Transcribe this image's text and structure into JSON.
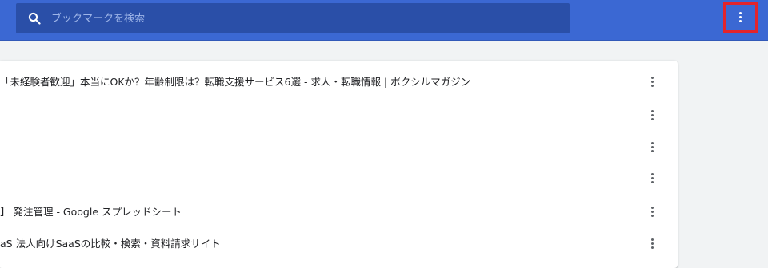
{
  "colors": {
    "toolbar": "#3b68d3",
    "search_bg": "#2a4fa8",
    "highlight": "#e3242b",
    "panel_bg": "#ffffff",
    "page_bg": "#f1f3f4",
    "text": "#202124",
    "icon_gray": "#5f6368"
  },
  "toolbar": {
    "search": {
      "icon": "search-icon",
      "placeholder": "ブックマークを検索",
      "value": ""
    },
    "menu": {
      "icon": "more-vert-icon",
      "highlighted": true
    }
  },
  "bookmarks": [
    {
      "title": "「未経験者歓迎」本当にOKか？年齢制限は？転職支援サービス6選 - 求人・転職情報 | ポクシルマガジン",
      "menu_icon": "more-vert-icon"
    },
    {
      "title": "",
      "menu_icon": "more-vert-icon"
    },
    {
      "title": "",
      "menu_icon": "more-vert-icon"
    },
    {
      "title": "",
      "menu_icon": "more-vert-icon"
    },
    {
      "title": "】 発注管理 - Google スプレッドシート",
      "menu_icon": "more-vert-icon"
    },
    {
      "title": "aS 法人向けSaaSの比較・検索・資料請求サイト",
      "menu_icon": "more-vert-icon"
    }
  ]
}
